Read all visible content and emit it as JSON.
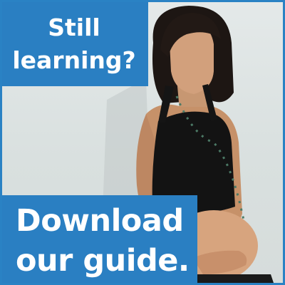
{
  "ad": {
    "headline": {
      "line1": "Still",
      "line2": "learning?"
    },
    "cta": {
      "line1": "Download",
      "line2": "our guide."
    },
    "photo_subject": "pregnant woman in black halter top",
    "colors": {
      "box": "#2a7fc2",
      "border": "#2a82c4",
      "text": "#ffffff"
    }
  }
}
